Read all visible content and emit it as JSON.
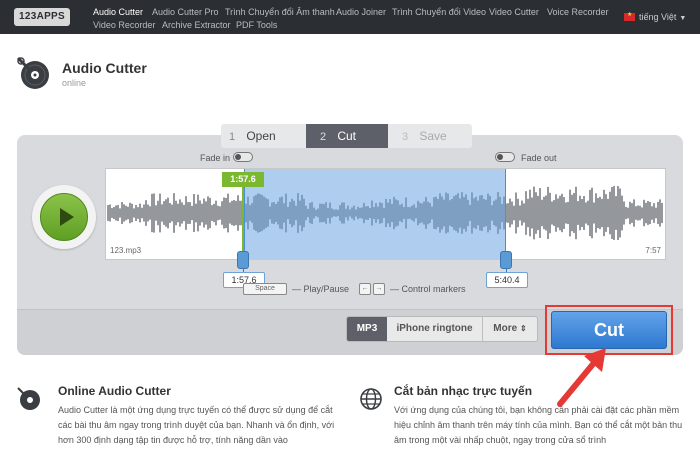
{
  "nav": {
    "logo": "123APPS",
    "links": [
      "Audio Cutter",
      "Audio Cutter Pro",
      "Trình Chuyển đổi Âm thanh",
      "Audio Joiner",
      "Trình Chuyển đổi Video",
      "Video Cutter",
      "Voice Recorder",
      "Video Recorder",
      "Archive Extractor",
      "PDF Tools"
    ],
    "active_link": "Audio Cutter",
    "language": "tiếng Việt"
  },
  "header": {
    "title": "Audio Cutter",
    "subtitle": "online"
  },
  "steps": [
    {
      "num": "1",
      "label": "Open"
    },
    {
      "num": "2",
      "label": "Cut"
    },
    {
      "num": "3",
      "label": "Save"
    }
  ],
  "editor": {
    "fade_in": "Fade in",
    "fade_out": "Fade out",
    "file_name": "123.mp3",
    "duration": "7:57",
    "start_marker": "1:57.6",
    "start_time": "1:57.6",
    "end_time": "5:40.4",
    "hint_space_key": "Space",
    "hint_play": "— Play/Pause",
    "hint_left_key": "←",
    "hint_right_key": "→",
    "hint_markers": "— Control markers"
  },
  "formats": {
    "mp3": "MP3",
    "iphone": "iPhone ringtone",
    "more": "More"
  },
  "cut_button": "Cut",
  "sections": [
    {
      "title": "Online Audio Cutter",
      "text": "Audio Cutter là một ứng dụng trực tuyến có thể được sử dụng để cắt các bài thu âm ngay trong trình duyệt của bạn. Nhanh và ổn định, với hơn 300 định dạng tập tin được hỗ trợ, tính năng dần vào"
    },
    {
      "title": "Cắt bản nhạc trực tuyến",
      "text": "Với ứng dụng của chúng tôi, bạn không cần phải cài đặt các phần mềm hiệu chỉnh âm thanh trên máy tính của mình. Bạn có thể cắt một bản thu âm trong một vài nhấp chuột, ngay trong cửa sổ trình"
    }
  ],
  "colors": {
    "accent_blue": "#3d86d8",
    "play_green": "#72ad33",
    "highlight_red": "#e53935"
  }
}
